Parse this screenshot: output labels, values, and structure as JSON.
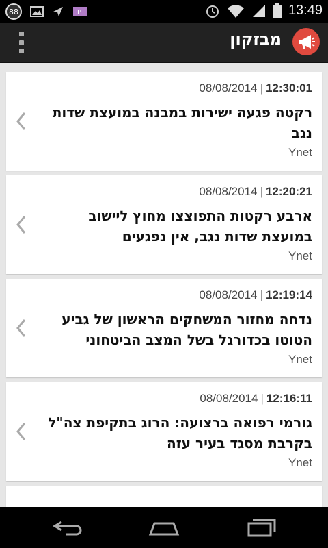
{
  "status_bar": {
    "notification_count": "88",
    "time": "13:49"
  },
  "app_bar": {
    "title": "מבזקון"
  },
  "news": [
    {
      "date": "08/08/2014",
      "time": "12:30:01",
      "title": "רקטה פגעה ישירות במבנה במועצת שדות נגב",
      "source": "Ynet"
    },
    {
      "date": "08/08/2014",
      "time": "12:20:21",
      "title": "ארבע רקטות התפוצצו מחוץ ליישוב במועצת שדות נגב, אין נפגעים",
      "source": "Ynet"
    },
    {
      "date": "08/08/2014",
      "time": "12:19:14",
      "title": "נדחה מחזור המשחקים הראשון של גביע הטוטו בכדורגל בשל המצב הביטחוני",
      "source": "Ynet"
    },
    {
      "date": "08/08/2014",
      "time": "12:16:11",
      "title": "גורמי רפואה ברצועה: הרוג בתקיפת צה\"ל בקרבת מסגד בעיר עזה",
      "source": "Ynet"
    }
  ],
  "icons": {
    "app_logo": "megaphone-icon",
    "overflow": "overflow-menu-icon",
    "chevron": "chevron-left-icon"
  },
  "colors": {
    "app_bar": "#222222",
    "logo": "#e04a3f"
  }
}
